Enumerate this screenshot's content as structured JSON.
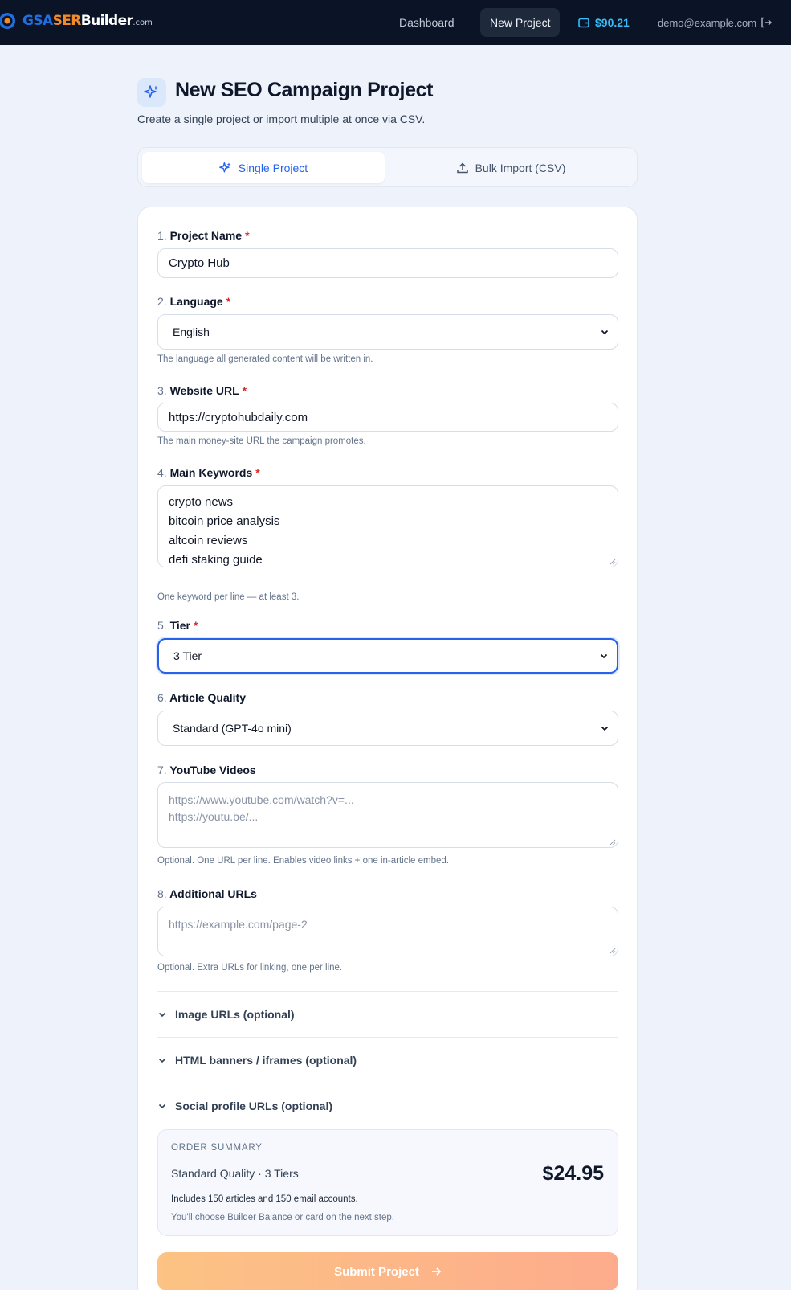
{
  "brand": {
    "gsa": "GSA",
    "ser": "SER",
    "builder": "Builder",
    "com": ".com"
  },
  "nav": {
    "dashboard": "Dashboard",
    "new_project": "New Project",
    "balance": "$90.21",
    "user_email": "demo@example.com"
  },
  "header": {
    "title": "New SEO Campaign Project",
    "subtitle": "Create a single project or import multiple at once via CSV."
  },
  "tabs": {
    "single": "Single Project",
    "bulk": "Bulk Import (CSV)"
  },
  "form": {
    "project_name": {
      "num": "1.",
      "label": "Project Name",
      "required": "*",
      "value": "Crypto Hub"
    },
    "language": {
      "num": "2.",
      "label": "Language",
      "required": "*",
      "value": "English",
      "help": "The language all generated content will be written in."
    },
    "website_url": {
      "num": "3.",
      "label": "Website URL",
      "required": "*",
      "value": "https://cryptohubdaily.com",
      "help": "The main money-site URL the campaign promotes."
    },
    "keywords": {
      "num": "4.",
      "label": "Main Keywords",
      "required": "*",
      "lines": [
        "crypto news",
        "bitcoin price analysis",
        "altcoin reviews",
        "defi staking guide"
      ],
      "help": "One keyword per line — at least 3."
    },
    "tier": {
      "num": "5.",
      "label": "Tier",
      "required": "*",
      "value": "3 Tier"
    },
    "article_quality": {
      "num": "6.",
      "label": "Article Quality",
      "value": "Standard (GPT-4o mini)"
    },
    "youtube": {
      "num": "7.",
      "label": "YouTube Videos",
      "placeholder_1": "https://www.youtube.com/watch?v=...",
      "placeholder_2": "https://youtu.be/...",
      "help": "Optional. One URL per line. Enables video links + one in-article embed."
    },
    "additional_urls": {
      "num": "8.",
      "label": "Additional URLs",
      "placeholder": "https://example.com/page-2",
      "help": "Optional. Extra URLs for linking, one per line."
    },
    "sections": {
      "images": "Image URLs (optional)",
      "banners": "HTML banners / iframes (optional)",
      "social": "Social profile URLs (optional)"
    }
  },
  "summary": {
    "heading": "ORDER SUMMARY",
    "description": "Standard Quality · 3 Tiers",
    "price": "$24.95",
    "includes": "Includes 150 articles and 150 email accounts.",
    "note": "You'll choose Builder Balance or card on the next step."
  },
  "submit": {
    "label": "Submit Project"
  },
  "colors": {
    "accent": "#2563eb",
    "nav_bg": "#0b1426",
    "balance": "#38bdf8",
    "required": "#dc2626"
  }
}
